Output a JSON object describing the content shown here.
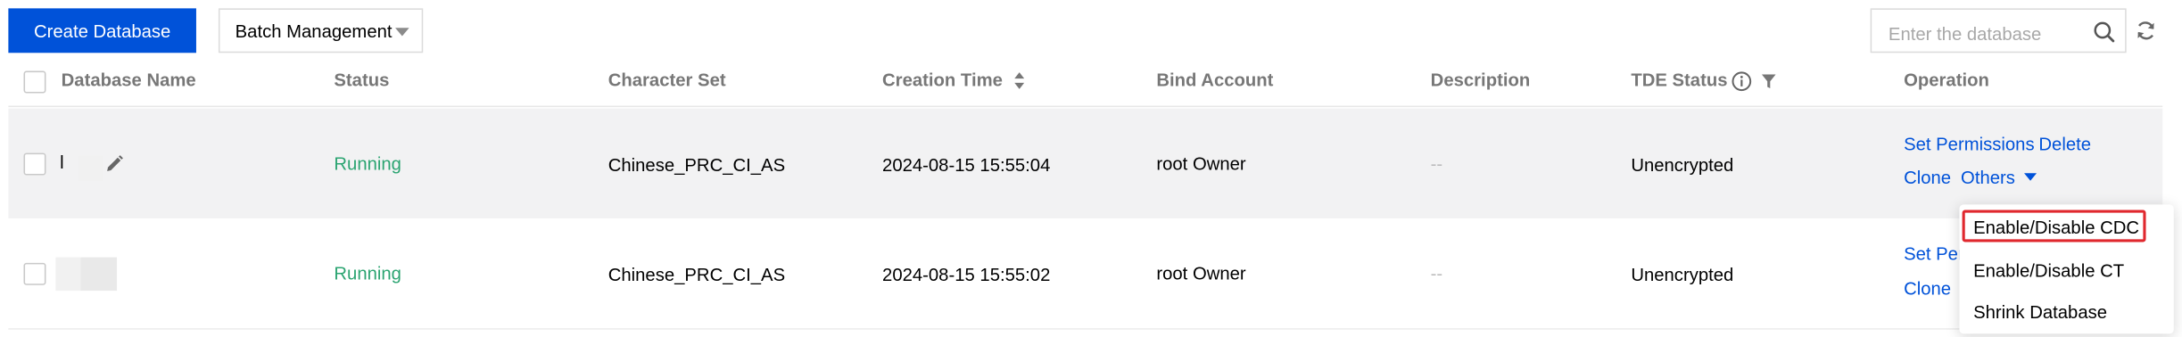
{
  "toolbar": {
    "create_label": "Create Database",
    "batch_label": "Batch Management",
    "search_placeholder": "Enter the database"
  },
  "icons": {
    "search": "search-icon",
    "refresh": "refresh-icon",
    "sort": "sort-icon",
    "info": "info-icon",
    "filter": "filter-icon",
    "edit": "pencil-icon",
    "dropdown": "caret-down-icon"
  },
  "colors": {
    "primary": "#0052d9",
    "running": "#2ba471",
    "highlight_border": "#e0282e",
    "hover_row": "#f2f2f3"
  },
  "table": {
    "columns": {
      "name": "Database Name",
      "status": "Status",
      "charset": "Character Set",
      "time": "Creation Time",
      "account": "Bind Account",
      "description": "Description",
      "tde": "TDE Status",
      "operation": "Operation"
    },
    "rows": [
      {
        "name": "l",
        "status": "Running",
        "charset": "Chinese_PRC_CI_AS",
        "time": "2024-08-15 15:55:04",
        "account": "root Owner",
        "description": "--",
        "tde": "Unencrypted"
      },
      {
        "status": "Running",
        "charset": "Chinese_PRC_CI_AS",
        "time": "2024-08-15 15:55:02",
        "account": "root Owner",
        "description": "--",
        "tde": "Unencrypted"
      }
    ]
  },
  "operations": {
    "set_permissions": "Set Permissions",
    "delete": "Delete",
    "clone": "Clone",
    "others": "Others",
    "set_permissions_partial": "Set Per"
  },
  "dropdown": {
    "items": [
      "Enable/Disable CDC",
      "Enable/Disable CT",
      "Shrink Database"
    ]
  }
}
